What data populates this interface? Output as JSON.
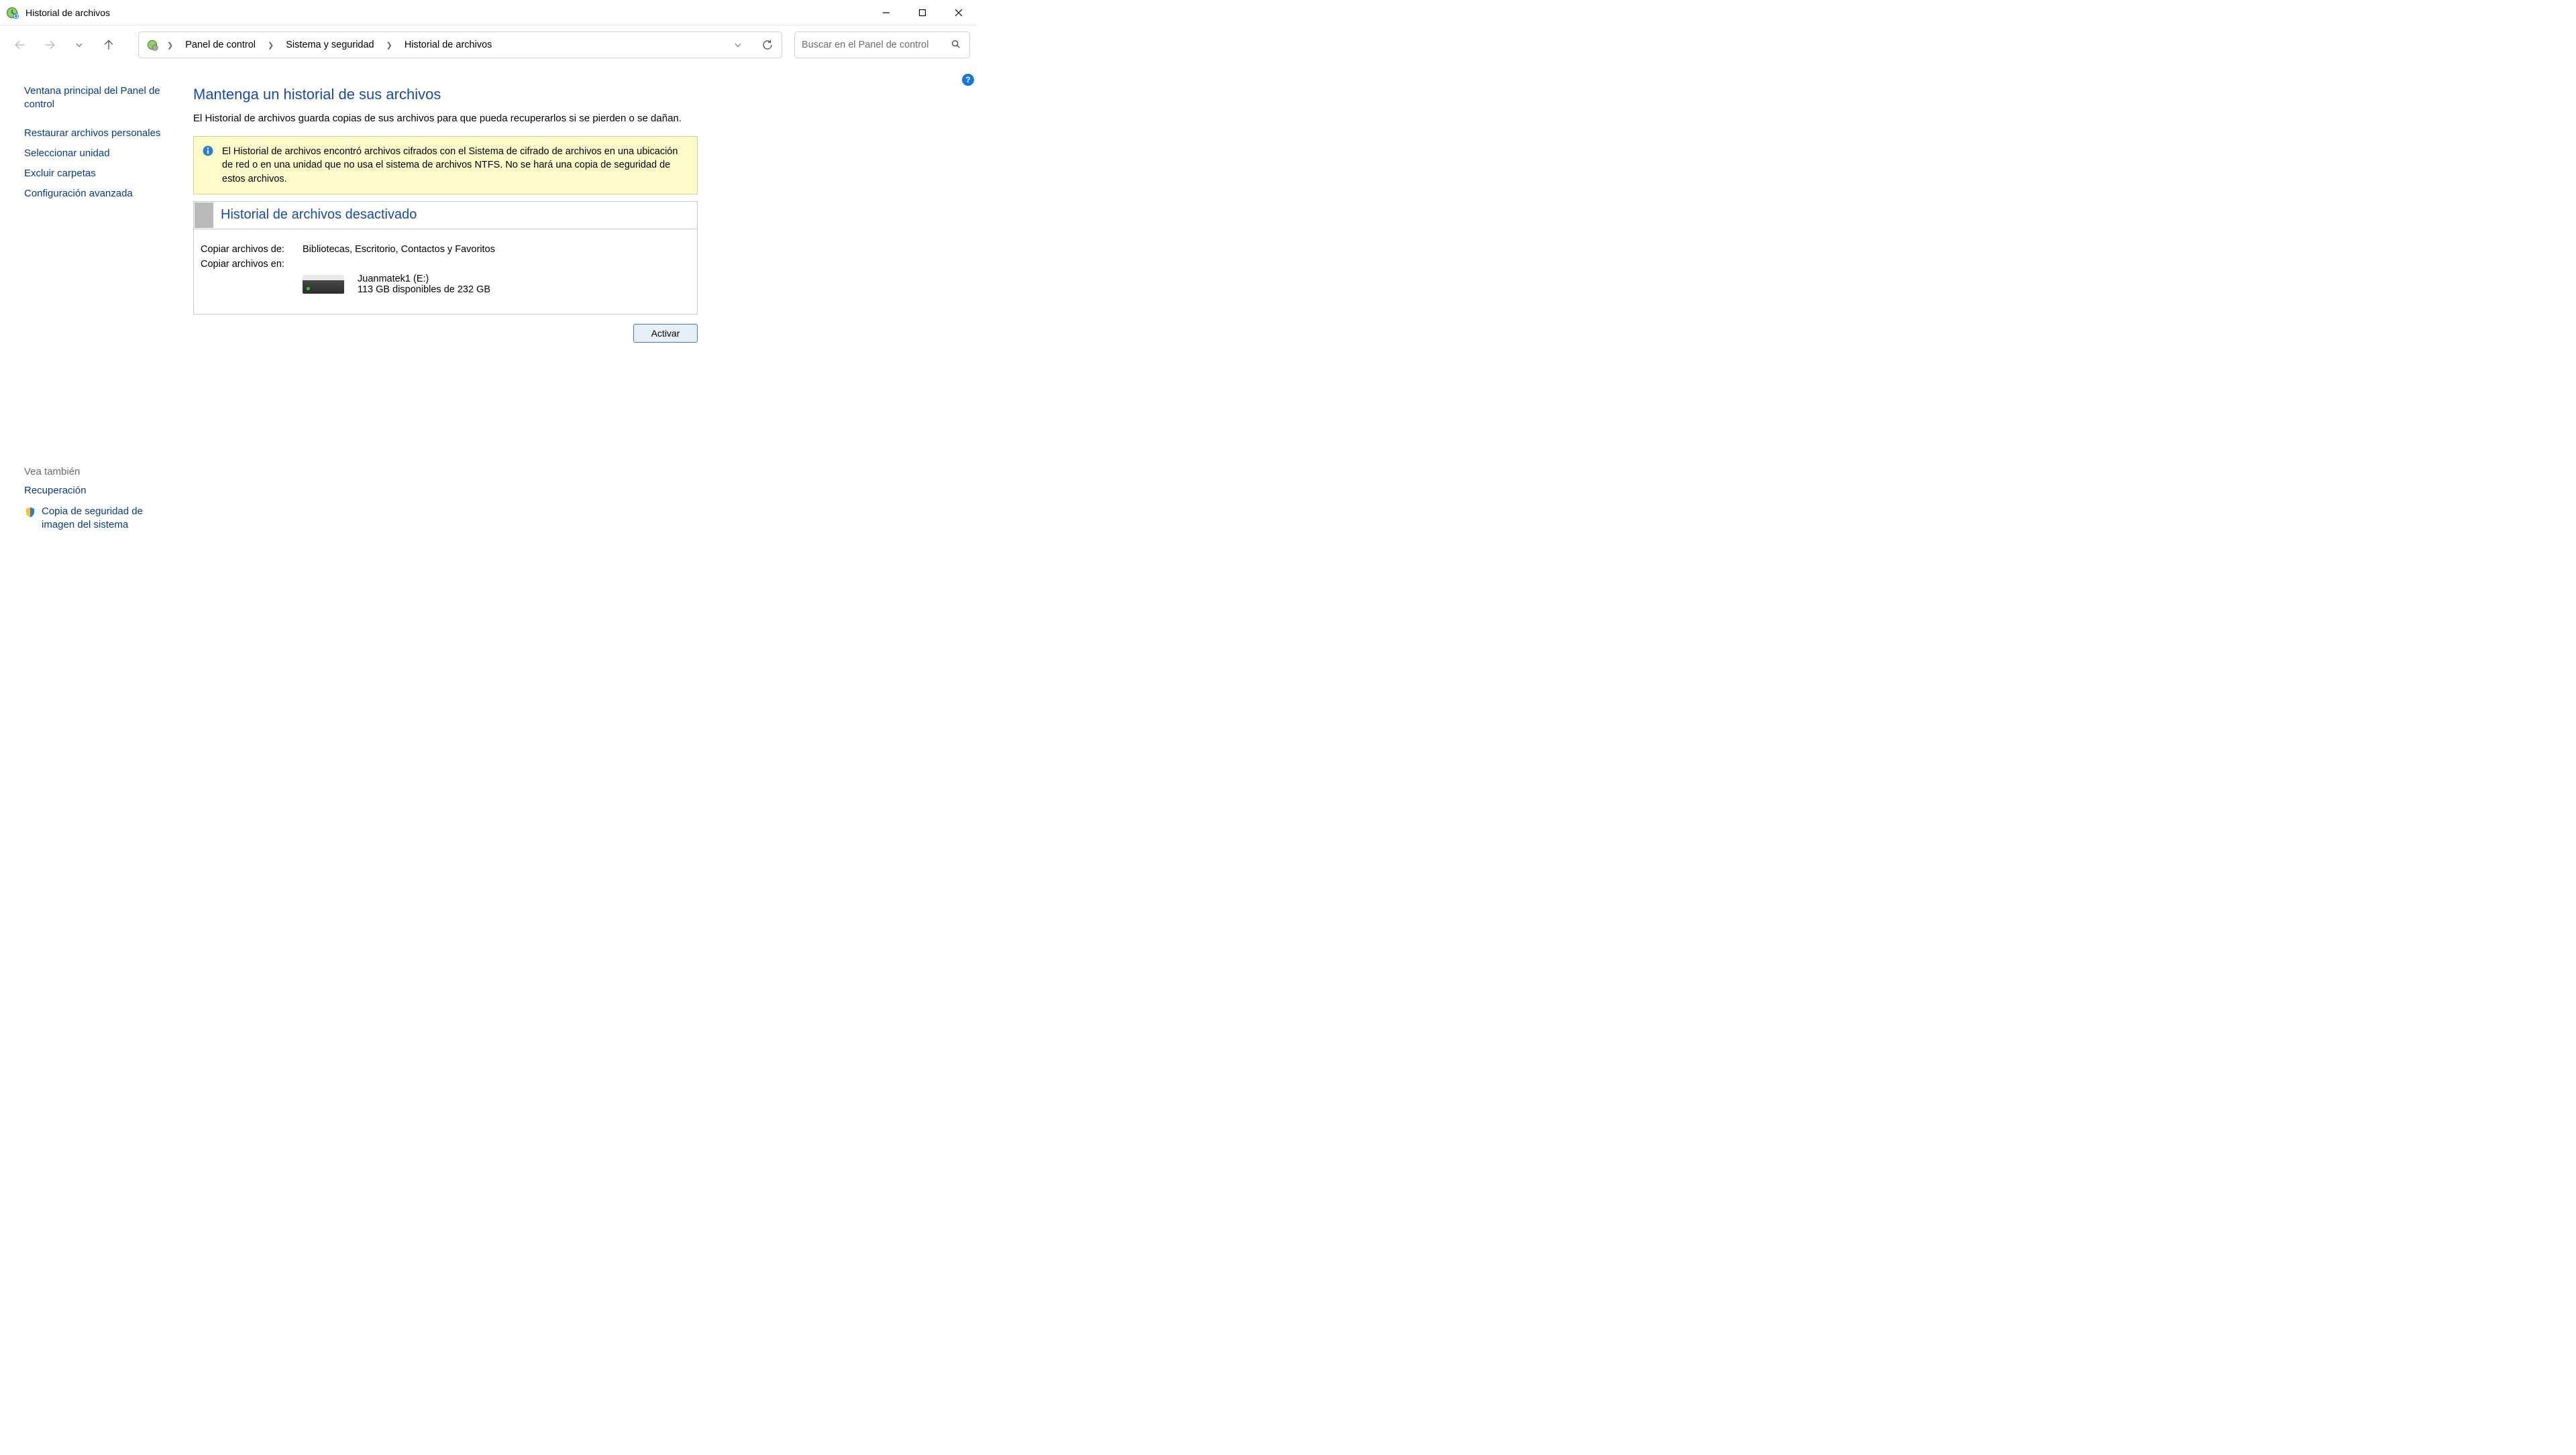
{
  "window": {
    "title": "Historial de archivos"
  },
  "breadcrumb": {
    "root": "Panel de control",
    "mid": "Sistema y seguridad",
    "leaf": "Historial de archivos"
  },
  "search": {
    "placeholder": "Buscar en el Panel de control"
  },
  "sidebar": {
    "mainlink": "Ventana principal del Panel de control",
    "links": [
      "Restaurar archivos personales",
      "Seleccionar unidad",
      "Excluir carpetas",
      "Configuración avanzada"
    ],
    "see_also_label": "Vea también",
    "see_also": [
      "Recuperación",
      "Copia de seguridad de imagen del sistema"
    ]
  },
  "main": {
    "heading": "Mantenga un historial de sus archivos",
    "description": "El Historial de archivos guarda copias de sus archivos para que pueda recuperarlos si se pierden o se dañan.",
    "alert": "El Historial de archivos encontró archivos cifrados con el Sistema de cifrado de archivos en una ubicación de red o en una unidad que no usa el sistema de archivos NTFS. No se hará una copia de seguridad de estos archivos.",
    "status_title": "Historial de archivos desactivado",
    "copy_from_label": "Copiar archivos de:",
    "copy_from_value": "Bibliotecas, Escritorio, Contactos y Favoritos",
    "copy_to_label": "Copiar archivos en:",
    "drive_name": "Juanmatek1 (E:)",
    "drive_space": "113 GB disponibles de 232 GB",
    "activate_label": "Activar"
  }
}
